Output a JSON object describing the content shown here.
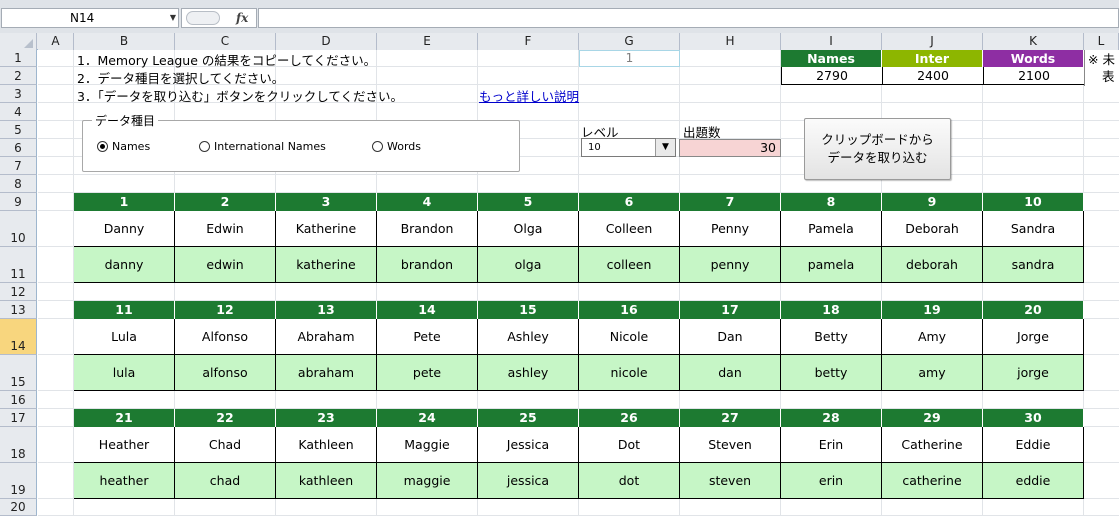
{
  "formula_bar": {
    "name_box": "N14",
    "fx_label": "fx",
    "formula": ""
  },
  "columns": [
    "A",
    "B",
    "C",
    "D",
    "E",
    "F",
    "G",
    "H",
    "I",
    "J",
    "K",
    "L"
  ],
  "rows": [
    "1",
    "2",
    "3",
    "4",
    "5",
    "6",
    "7",
    "8",
    "9",
    "10",
    "11",
    "12",
    "13",
    "14",
    "15",
    "16",
    "17",
    "18",
    "19",
    "20"
  ],
  "selected_row": "14",
  "instructions": [
    "1．Memory League の結果をコピーしてください。",
    "2．データ種目を選択してください。",
    "3．「データを取り込む」ボタンをクリックしてください。"
  ],
  "detail_link": "もっと詳しい説明",
  "g1_value": "1",
  "scores": {
    "headers": [
      "Names",
      "Inter",
      "Words"
    ],
    "values": [
      "2790",
      "2400",
      "2100"
    ],
    "colors": [
      "#1d7a31",
      "#8db600",
      "#8e2ea3"
    ]
  },
  "note": {
    "line1": "※ 未",
    "line2": "表"
  },
  "data_type": {
    "title": "データ種目",
    "options": [
      "Names",
      "International Names",
      "Words"
    ],
    "selected": "Names"
  },
  "level": {
    "label": "レベル",
    "value": "10"
  },
  "count": {
    "label": "出題数",
    "value": "30"
  },
  "import_button": {
    "line1": "クリップボードから",
    "line2": "データを取り込む"
  },
  "blocks": [
    {
      "numbers": [
        "1",
        "2",
        "3",
        "4",
        "5",
        "6",
        "7",
        "8",
        "9",
        "10"
      ],
      "names": [
        "Danny",
        "Edwin",
        "Katherine",
        "Brandon",
        "Olga",
        "Colleen",
        "Penny",
        "Pamela",
        "Deborah",
        "Sandra"
      ],
      "answers": [
        "danny",
        "edwin",
        "katherine",
        "brandon",
        "olga",
        "colleen",
        "penny",
        "pamela",
        "deborah",
        "sandra"
      ]
    },
    {
      "numbers": [
        "11",
        "12",
        "13",
        "14",
        "15",
        "16",
        "17",
        "18",
        "19",
        "20"
      ],
      "names": [
        "Lula",
        "Alfonso",
        "Abraham",
        "Pete",
        "Ashley",
        "Nicole",
        "Dan",
        "Betty",
        "Amy",
        "Jorge"
      ],
      "answers": [
        "lula",
        "alfonso",
        "abraham",
        "pete",
        "ashley",
        "nicole",
        "dan",
        "betty",
        "amy",
        "jorge"
      ]
    },
    {
      "numbers": [
        "21",
        "22",
        "23",
        "24",
        "25",
        "26",
        "27",
        "28",
        "29",
        "30"
      ],
      "names": [
        "Heather",
        "Chad",
        "Kathleen",
        "Maggie",
        "Jessica",
        "Dot",
        "Steven",
        "Erin",
        "Catherine",
        "Eddie"
      ],
      "answers": [
        "heather",
        "chad",
        "kathleen",
        "maggie",
        "jessica",
        "dot",
        "steven",
        "erin",
        "catherine",
        "eddie"
      ]
    }
  ]
}
